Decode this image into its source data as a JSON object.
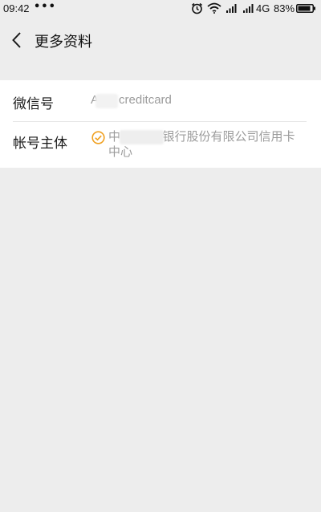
{
  "status_bar": {
    "time": "09:42",
    "more": "•••",
    "network": "4G",
    "battery": "83%"
  },
  "nav": {
    "title": "更多资料",
    "back_icon": "chevron-left-icon"
  },
  "info": {
    "wechat_label": "微信号",
    "wechat_value": "A      creditcard",
    "account_label": "帐号主体",
    "account_value": "中           银行股份有限公司信用卡中心",
    "verified_icon": "verified-check-icon",
    "verified_color": "#f0a020"
  },
  "colors": {
    "background": "#ededed",
    "card": "#ffffff",
    "secondary_text": "#9b9b9b"
  }
}
